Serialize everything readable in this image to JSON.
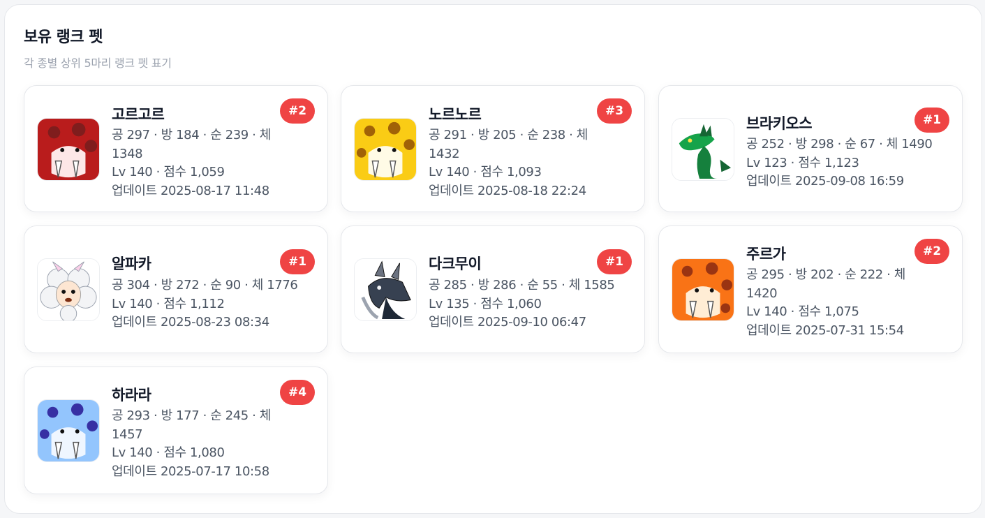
{
  "panel": {
    "title": "보유 랭크 펫",
    "subtitle": "각 종별 상위 5마리 랭크 펫 표기"
  },
  "pets": [
    {
      "name": "고르고르",
      "rank": "#2",
      "stats": "공 297 · 방 184 · 순 239 · 체 1348",
      "level_score": "Lv 140 · 점수 1,059",
      "updated": "업데이트 2025-08-17 11:48",
      "icon": "red-sabertooth-icon"
    },
    {
      "name": "노르노르",
      "rank": "#3",
      "stats": "공 291 · 방 205 · 순 238 · 체 1432",
      "level_score": "Lv 140 · 점수 1,093",
      "updated": "업데이트 2025-08-18 22:24",
      "icon": "yellow-sabertooth-icon"
    },
    {
      "name": "브라키오스",
      "rank": "#1",
      "stats": "공 252 · 방 298 · 순 67 · 체 1490",
      "level_score": "Lv 123 · 점수 1,123",
      "updated": "업데이트 2025-09-08 16:59",
      "icon": "green-dinosaur-icon"
    },
    {
      "name": "알파카",
      "rank": "#1",
      "stats": "공 304 · 방 272 · 순 90 · 체 1776",
      "level_score": "Lv 140 · 점수 1,112",
      "updated": "업데이트 2025-08-23 08:34",
      "icon": "alpaca-icon"
    },
    {
      "name": "다크무이",
      "rank": "#1",
      "stats": "공 285 · 방 286 · 순 55 · 체 1585",
      "level_score": "Lv 135 · 점수 1,060",
      "updated": "업데이트 2025-09-10 06:47",
      "icon": "dark-dinosaur-icon"
    },
    {
      "name": "주르가",
      "rank": "#2",
      "stats": "공 295 · 방 202 · 순 222 · 체 1420",
      "level_score": "Lv 140 · 점수 1,075",
      "updated": "업데이트 2025-07-31 15:54",
      "icon": "orange-sabertooth-icon"
    },
    {
      "name": "하라라",
      "rank": "#4",
      "stats": "공 293 · 방 177 · 순 245 · 체 1457",
      "level_score": "Lv 140 · 점수 1,080",
      "updated": "업데이트 2025-07-17 10:58",
      "icon": "blue-sabertooth-icon"
    }
  ],
  "colors": {
    "badge": "#ef4444",
    "title": "#111827",
    "subtitle": "#9ca3af",
    "info_text": "#4b5563"
  }
}
